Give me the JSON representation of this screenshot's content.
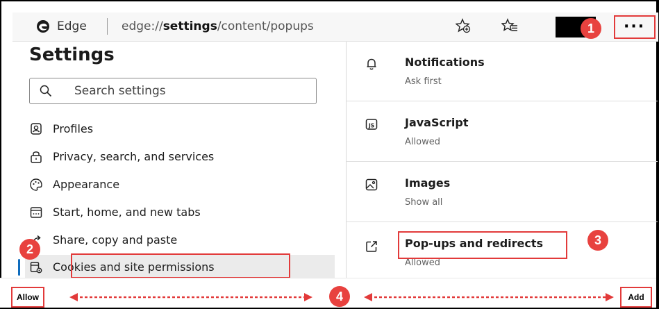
{
  "browser": {
    "name": "Edge",
    "url_prefix": "edge://",
    "url_bold": "settings",
    "url_suffix": "/content/popups",
    "more_label": "···"
  },
  "callouts": {
    "c1": "1",
    "c2": "2",
    "c3": "3",
    "c4": "4"
  },
  "settings": {
    "title": "Settings",
    "search_placeholder": "Search settings",
    "nav": [
      {
        "label": "Profiles",
        "icon": "profile-icon"
      },
      {
        "label": "Privacy, search, and services",
        "icon": "lock-icon"
      },
      {
        "label": "Appearance",
        "icon": "palette-icon"
      },
      {
        "label": "Start, home, and new tabs",
        "icon": "home-tabs-icon"
      },
      {
        "label": "Share, copy and paste",
        "icon": "share-icon"
      },
      {
        "label": "Cookies and site permissions",
        "icon": "cookies-permissions-icon",
        "active": true
      }
    ]
  },
  "permissions": [
    {
      "name": "Notifications",
      "status": "Ask first",
      "icon": "bell-icon"
    },
    {
      "name": "JavaScript",
      "status": "Allowed",
      "icon": "js-icon"
    },
    {
      "name": "Images",
      "status": "Show all",
      "icon": "image-icon"
    },
    {
      "name": "Pop-ups and redirects",
      "status": "Allowed",
      "icon": "open-external-icon"
    }
  ],
  "bottom": {
    "allow_label": "Allow",
    "add_label": "Add"
  },
  "colors": {
    "accent_red": "#e23a3a",
    "callout_red": "#e8423f",
    "active_blue": "#0f6cbd"
  }
}
